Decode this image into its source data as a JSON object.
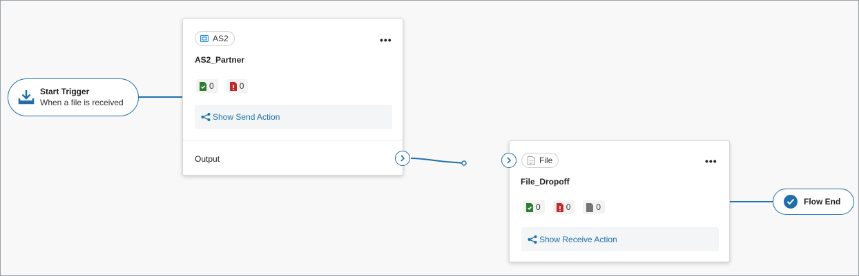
{
  "start_trigger": {
    "title": "Start Trigger",
    "subtitle": "When a file is received",
    "icon": "download-icon"
  },
  "as2_card": {
    "tag": "AS2",
    "tag_icon": "as2-icon",
    "more": "•••",
    "title": "AS2_Partner",
    "counts": [
      {
        "icon": "file-success-icon",
        "value": "0",
        "color": "#2e7d32"
      },
      {
        "icon": "file-error-icon",
        "value": "0",
        "color": "#c62828"
      }
    ],
    "action": "Show Send Action",
    "output": "Output"
  },
  "file_card": {
    "tag": "File",
    "tag_icon": "file-icon",
    "more": "•••",
    "title": "File_Dropoff",
    "counts": [
      {
        "icon": "file-success-icon",
        "value": "0",
        "color": "#2e7d32"
      },
      {
        "icon": "file-error-icon",
        "value": "0",
        "color": "#c62828"
      },
      {
        "icon": "file-pending-icon",
        "value": "0",
        "color": "#757575"
      }
    ],
    "action": "Show Receive Action"
  },
  "flow_end": {
    "label": "Flow End",
    "icon": "check-circle-icon"
  },
  "colors": {
    "accent": "#1f6fa8",
    "success": "#2e7d32",
    "error": "#c62828",
    "neutral": "#757575"
  }
}
